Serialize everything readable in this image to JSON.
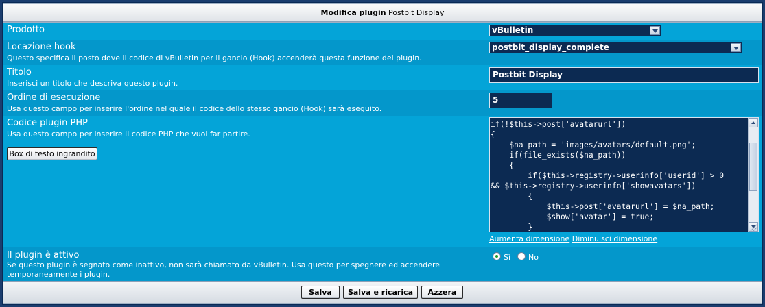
{
  "header": {
    "title_bold": "Modifica plugin",
    "title_rest": "Postbit Display"
  },
  "product": {
    "label": "Prodotto",
    "value": "vBulletin"
  },
  "hook": {
    "label": "Locazione hook",
    "description": "Questo specifica il posto dove il codice di vBulletin per il gancio (Hook) accenderà questa funzione del plugin.",
    "value": "postbit_display_complete"
  },
  "title": {
    "label": "Titolo",
    "description": "Inserisci un titolo che descriva questo plugin.",
    "value": "Postbit Display"
  },
  "order": {
    "label": "Ordine di esecuzione",
    "description": "Usa questo campo per inserire l'ordine nel quale il codice dello stesso gancio (Hook) sarà eseguito.",
    "value": "5"
  },
  "php": {
    "label": "Codice plugin PHP",
    "description": "Usa questo campo per inserire il codice PHP che vuoi far partire.",
    "big_box_button": "Box di testo ingrandito",
    "code": "if(!$this->post['avatarurl'])\n{\n    $na_path = 'images/avatars/default.png';\n    if(file_exists($na_path))\n    {\n        if($this->registry->userinfo['userid'] > 0\n&& $this->registry->userinfo['showavatars'])\n        {\n            $this->post['avatarurl'] = $na_path;\n            $show['avatar'] = true;\n        }",
    "increase_link": "Aumenta dimensione",
    "decrease_link": "Diminuisci dimensione"
  },
  "active": {
    "label": "Il plugin è attivo",
    "description_line1": "Se questo plugin è segnato come inattivo, non sarà chiamato da vBulletin. Usa questo per spegnere ed accendere",
    "description_line2": "temporaneamente i plugin.",
    "yes": "Sì",
    "no": "No",
    "selected": "yes"
  },
  "footer": {
    "save": "Salva",
    "save_reload": "Salva e ricarica",
    "reset": "Azzera"
  },
  "colors": {
    "row_bg": "#04a4d8",
    "field_bg": "#0c2a52",
    "frame": "#0a2a55"
  }
}
